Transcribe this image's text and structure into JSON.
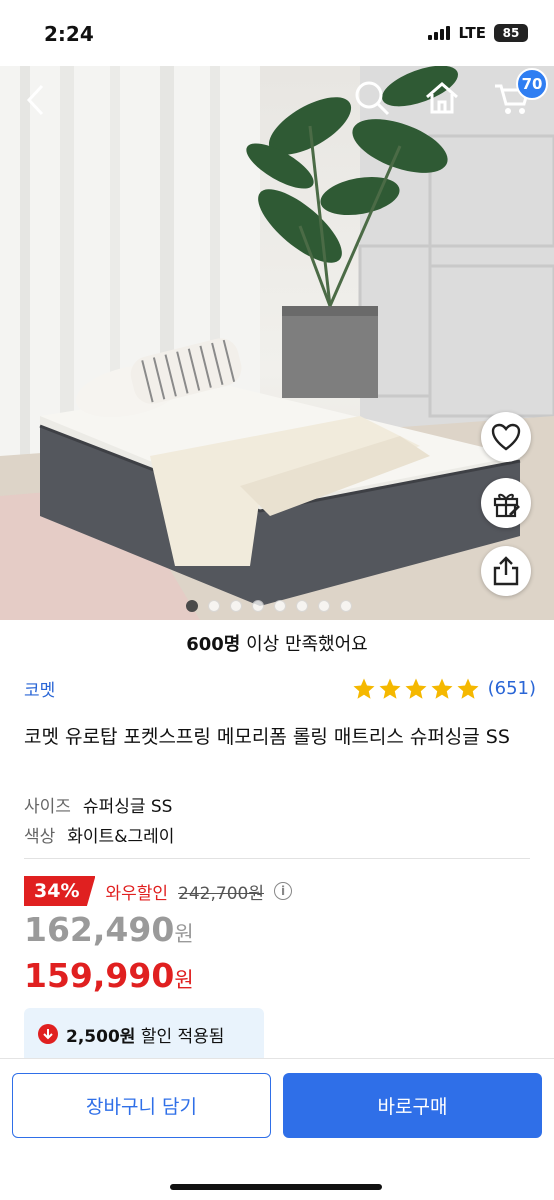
{
  "status": {
    "time": "2:24",
    "network": "LTE",
    "battery": "85"
  },
  "header": {
    "back_icon": "chevron-left-icon",
    "search_icon": "search-icon",
    "home_icon": "home-icon",
    "cart_icon": "cart-icon",
    "cart_count": "70"
  },
  "hero": {
    "actions": [
      "heart-icon",
      "gift-icon",
      "share-icon"
    ],
    "image_count": 8,
    "active_index": 0
  },
  "satisfaction": {
    "count": "600명",
    "rest": " 이상 만족했어요"
  },
  "brand": "코멧",
  "rating": {
    "stars": 5,
    "reviews": "(651)",
    "star_color": "#f5b800"
  },
  "product": {
    "title": "코멧 유로탑 포켓스프링 메모리폼 롤링 매트리스 슈퍼싱글 SS",
    "size_label": "사이즈",
    "size_value": "슈퍼싱글 SS",
    "color_label": "색상",
    "color_value": "화이트&그레이"
  },
  "pricing": {
    "discount_pct": "34%",
    "wow_label": "와우할인",
    "original_price": "242,700원",
    "info_icon": "i",
    "price_before": "162,490",
    "price_final": "159,990",
    "won": "원",
    "accent_color": "#e02020"
  },
  "coupon": {
    "amount": "2,500원",
    "text": " 할인 적용됨"
  },
  "actions": {
    "add_to_cart": "장바구니 담기",
    "buy_now": "바로구매",
    "primary_color": "#2f6fe8"
  }
}
